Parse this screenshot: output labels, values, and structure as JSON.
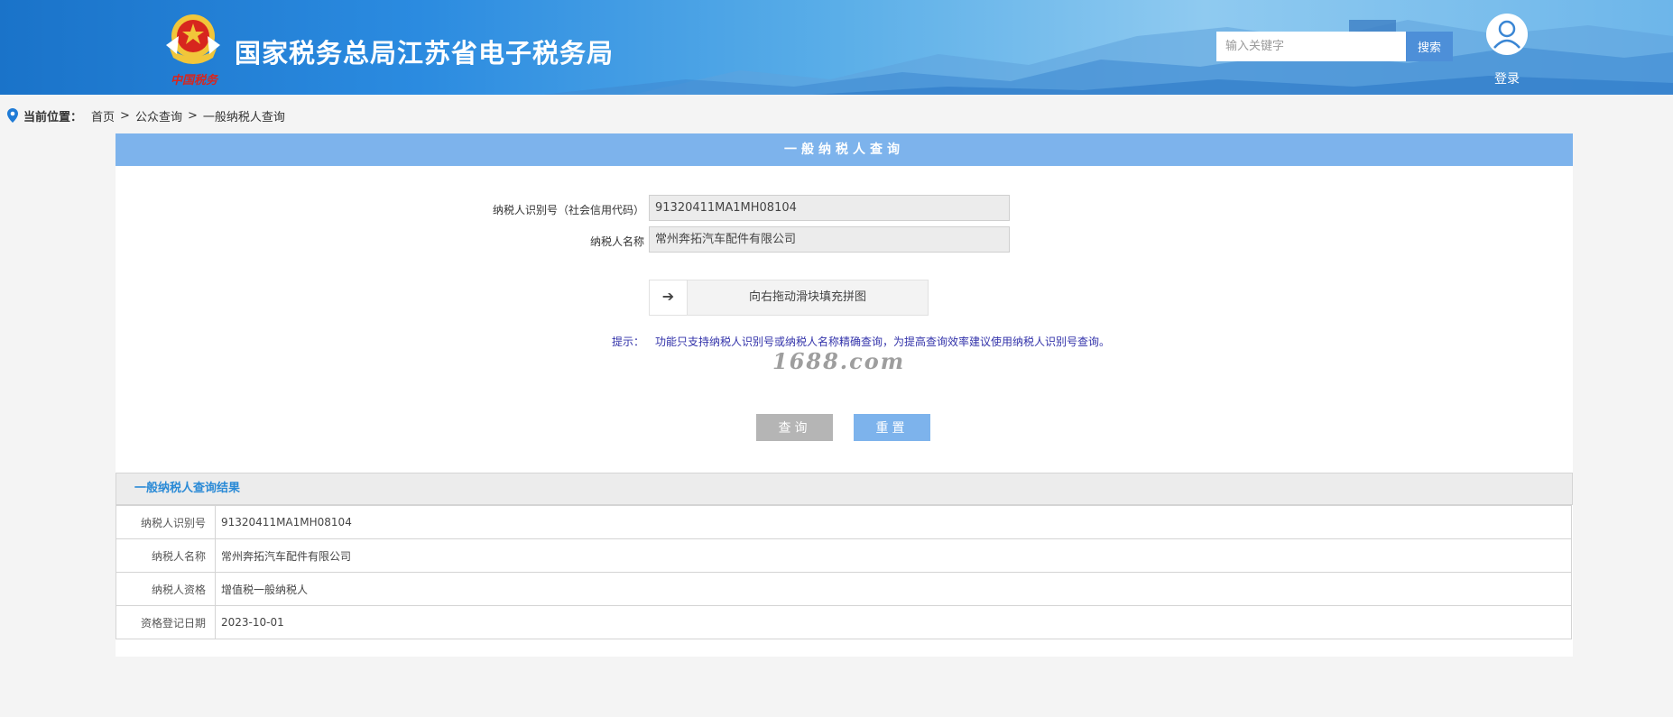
{
  "header": {
    "site_title": "国家税务总局江苏省电子税务局",
    "emblem_text": "中国税务",
    "search_placeholder": "输入关键字",
    "search_button": "搜索",
    "login": "登录"
  },
  "breadcrumb": {
    "label": "当前位置：",
    "sep": ">",
    "items": [
      "首页",
      "公众查询",
      "一般纳税人查询"
    ]
  },
  "query": {
    "title": "一般纳税人查询",
    "id_label": "纳税人识别号（社会信用代码）",
    "id_value": "91320411MA1MH08104",
    "name_label": "纳税人名称",
    "name_value": "常州奔拓汽车配件有限公司",
    "slider_arrow": "➔",
    "slider_text": "向右拖动滑块填充拼图",
    "tip_label": "提示：",
    "tip_text": "功能只支持纳税人识别号或纳税人名称精确查询，为提高查询效率建议使用纳税人识别号查询。",
    "watermark": "1688.com",
    "query_button": "查询",
    "reset_button": "重置"
  },
  "result": {
    "title": "一般纳税人查询结果",
    "rows": [
      {
        "label": "纳税人识别号",
        "value": "91320411MA1MH08104"
      },
      {
        "label": "纳税人名称",
        "value": "常州奔拓汽车配件有限公司"
      },
      {
        "label": "纳税人资格",
        "value": "增值税一般纳税人"
      },
      {
        "label": "资格登记日期",
        "value": "2023-10-01"
      }
    ]
  },
  "colors": {
    "header_blue": "#1a73c9",
    "panel_bar": "#7db3ec",
    "result_title": "#2a8ad6",
    "tip_text": "#3333aa",
    "query_button": "#b5b5b5"
  },
  "icons": [
    "tax-emblem-icon",
    "user-icon",
    "location-pin-icon",
    "arrow-right-icon"
  ]
}
